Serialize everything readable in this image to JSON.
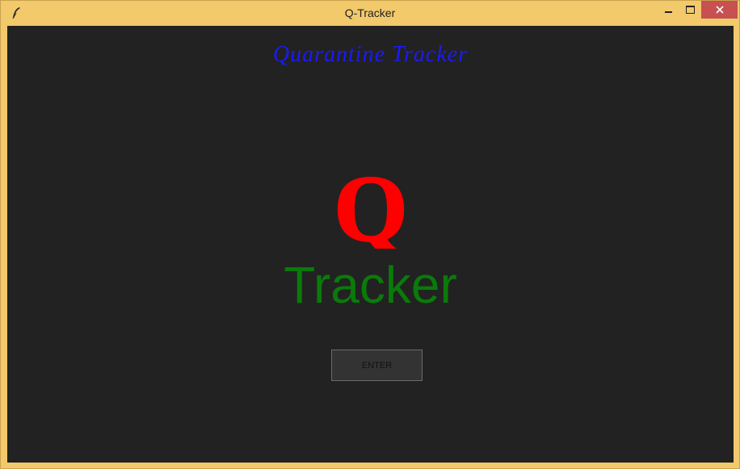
{
  "window": {
    "title": "Q-Tracker",
    "icon": "feather-icon",
    "controls": [
      "minimize-icon",
      "maximize-icon",
      "close-icon"
    ]
  },
  "main": {
    "heading": "Quarantine Tracker",
    "logo_letter": "Q",
    "logo_word": "Tracker",
    "enter_label": "ENTER"
  },
  "colors": {
    "titlebar": "#f2c96b",
    "background": "#222222",
    "heading": "#1a1aff",
    "logo_letter": "#ff0000",
    "logo_word": "#0a7a0a",
    "close_button": "#c75050"
  }
}
